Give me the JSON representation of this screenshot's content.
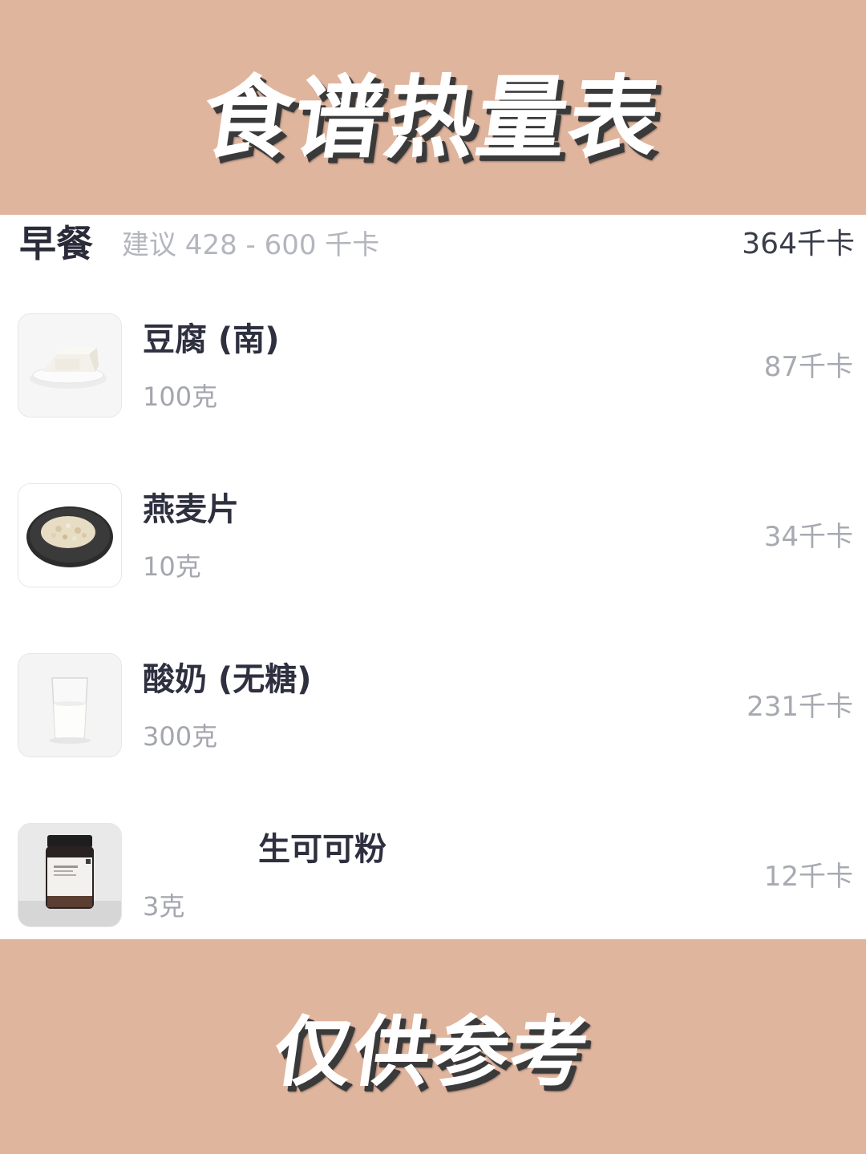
{
  "banner_top": {
    "title": "食谱热量表"
  },
  "meal": {
    "title": "早餐",
    "suggestion": "建议 428 - 600 千卡",
    "total": "364千卡"
  },
  "foods": [
    {
      "name": "豆腐 (南)",
      "quantity": "100克",
      "kcal": "87千卡",
      "icon": "tofu-plate-icon"
    },
    {
      "name": "燕麦片",
      "quantity": "10克",
      "kcal": "34千卡",
      "icon": "oats-plate-icon"
    },
    {
      "name": "酸奶 (无糖)",
      "quantity": "300克",
      "kcal": "231千卡",
      "icon": "yogurt-glass-icon"
    },
    {
      "name": "生可可粉",
      "quantity": "3克",
      "kcal": "12千卡",
      "icon": "cocoa-jar-icon"
    }
  ],
  "banner_bottom": {
    "title": "仅供参考"
  },
  "colors": {
    "banner_bg": "#e0b59e",
    "card_bg": "#ffffff",
    "title_text": "#2a2c3a",
    "secondary_text": "#a8aab2"
  }
}
